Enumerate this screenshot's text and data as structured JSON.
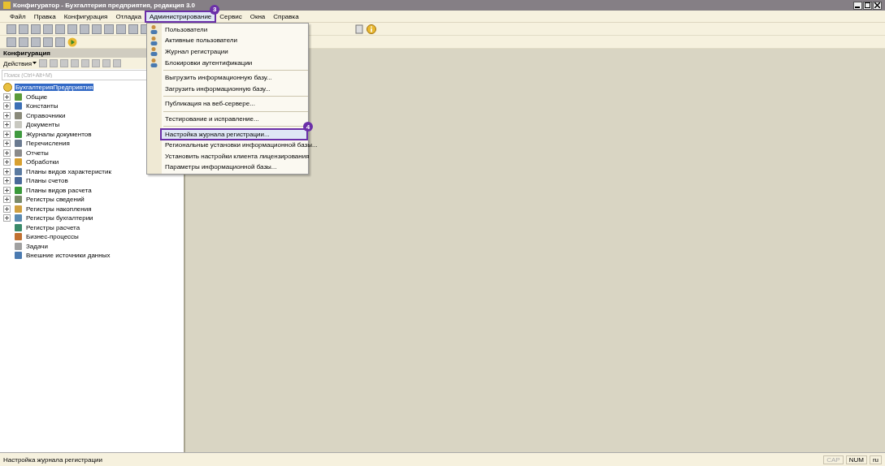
{
  "window": {
    "title": "Конфигуратор - Бухгалтерия предприятия, редакция 3.0"
  },
  "menubar": [
    {
      "label": "Файл",
      "selected": false
    },
    {
      "label": "Правка",
      "selected": false
    },
    {
      "label": "Конфигурация",
      "selected": false
    },
    {
      "label": "Отладка",
      "selected": false
    },
    {
      "label": "Администрирование",
      "selected": true,
      "badge": "3"
    },
    {
      "label": "Сервис",
      "selected": false
    },
    {
      "label": "Окна",
      "selected": false
    },
    {
      "label": "Справка",
      "selected": false
    }
  ],
  "dropdown": {
    "groups": [
      [
        {
          "label": "Пользователи",
          "selected": false
        },
        {
          "label": "Активные пользователи",
          "selected": false
        },
        {
          "label": "Журнал регистрации",
          "selected": false
        },
        {
          "label": "Блокировки аутентификации",
          "selected": false
        }
      ],
      [
        {
          "label": "Выгрузить информационную базу...",
          "selected": false
        },
        {
          "label": "Загрузить информационную базу...",
          "selected": false
        }
      ],
      [
        {
          "label": "Публикация на веб-сервере...",
          "selected": false
        }
      ],
      [
        {
          "label": "Тестирование и исправление...",
          "selected": false
        }
      ],
      [
        {
          "label": "Настройка журнала регистрации...",
          "selected": true,
          "badge": "4"
        },
        {
          "label": "Региональные установки информационной базы...",
          "selected": false
        },
        {
          "label": "Установить настройки клиента лицензирования",
          "selected": false
        },
        {
          "label": "Параметры информационной базы...",
          "selected": false
        }
      ]
    ]
  },
  "panel": {
    "title": "Конфигурация",
    "actions": "Действия",
    "search": {
      "placeholder": "Поиск (Ctrl+Alt+M)"
    },
    "tree": {
      "label": "БухгалтерияПредприятия",
      "selected": true,
      "children": [
        {
          "label": "Общие",
          "expandable": true
        },
        {
          "label": "Константы",
          "expandable": true
        },
        {
          "label": "Справочники",
          "expandable": true
        },
        {
          "label": "Документы",
          "expandable": true
        },
        {
          "label": "Журналы документов",
          "expandable": true
        },
        {
          "label": "Перечисления",
          "expandable": true
        },
        {
          "label": "Отчеты",
          "expandable": true
        },
        {
          "label": "Обработки",
          "expandable": true
        },
        {
          "label": "Планы видов характеристик",
          "expandable": true
        },
        {
          "label": "Планы счетов",
          "expandable": true
        },
        {
          "label": "Планы видов расчета",
          "expandable": true
        },
        {
          "label": "Регистры сведений",
          "expandable": true
        },
        {
          "label": "Регистры накопления",
          "expandable": true
        },
        {
          "label": "Регистры бухгалтерии",
          "expandable": true
        },
        {
          "label": "Регистры расчета",
          "expandable": false
        },
        {
          "label": "Бизнес-процессы",
          "expandable": false
        },
        {
          "label": "Задачи",
          "expandable": false
        },
        {
          "label": "Внешние источники данных",
          "expandable": false
        }
      ]
    }
  },
  "status_bar": {
    "text": "Настройка журнала регистрации",
    "indicators": [
      {
        "label": "CAP",
        "on": false
      },
      {
        "label": "NUM",
        "on": true
      },
      {
        "label": "ru",
        "on": true
      }
    ]
  }
}
